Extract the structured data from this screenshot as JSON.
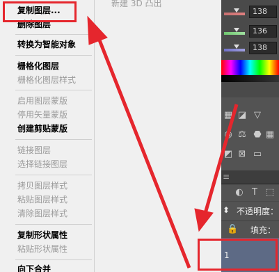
{
  "context_menu": {
    "items": [
      {
        "label": "复制图层...",
        "enabled": true
      },
      {
        "label": "删除图层",
        "enabled": true
      },
      {
        "label": "转换为智能对象",
        "enabled": true
      },
      {
        "label": "栅格化图层",
        "enabled": true
      },
      {
        "label": "栅格化图层样式",
        "enabled": false
      },
      {
        "label": "启用图层蒙版",
        "enabled": false
      },
      {
        "label": "停用矢量蒙版",
        "enabled": false
      },
      {
        "label": "创建剪贴蒙版",
        "enabled": true
      },
      {
        "label": "链接图层",
        "enabled": false
      },
      {
        "label": "选择链接图层",
        "enabled": false
      },
      {
        "label": "拷贝图层样式",
        "enabled": false
      },
      {
        "label": "粘贴图层样式",
        "enabled": false
      },
      {
        "label": "清除图层样式",
        "enabled": false
      },
      {
        "label": "复制形状属性",
        "enabled": true
      },
      {
        "label": "粘贴形状属性",
        "enabled": false
      },
      {
        "label": "向下合并",
        "enabled": true
      }
    ]
  },
  "submenu_area": {
    "text": "新建 3D 凸出"
  },
  "color_panel": {
    "values": [
      "138",
      "136",
      "138"
    ]
  },
  "layers_panel": {
    "opacity_label": "不透明度：",
    "fill_label": "填充：",
    "layer_number": "1"
  },
  "colors": {
    "annotation_red": "#e5262d",
    "menu_bg": "#f0f0f0",
    "panel_bg": "#535353",
    "selected_layer": "#5d6a85"
  }
}
